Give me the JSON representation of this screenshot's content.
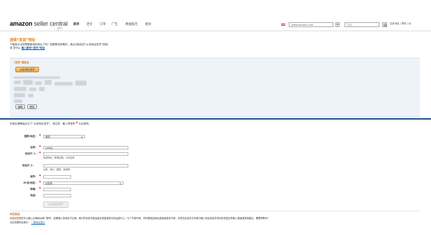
{
  "header": {
    "logo_main": "amazon",
    "logo_sub": " seller central",
    "flag_icon": "flag-icon",
    "nav": [
      "库存",
      "定价",
      "订单",
      "广告",
      "数据报告",
      "绩效"
    ],
    "marketplace": "www.amazon.com",
    "search_placeholder": "搜索",
    "right_links": "买家消息 | 帮助 | 设"
  },
  "section": {
    "title": "选择“发货”地址",
    "desc1": "下面显示出您想要使用的地址了吗？如果是这种情况，请点击相应的“从该地址发货”按钮。",
    "desc2_prefix": "或 您可以",
    "desc2_link": "输入新的“发货”地址",
    "default_label": "“发货”源签名",
    "ship_btn": "从此地址发货",
    "edit_btn": "编辑",
    "delete_btn": "删除"
  },
  "form": {
    "intro": "完成后请确保点击了“从该地址发货”。请注意：输入项带有",
    "intro_suffix": "为必填项。",
    "country_label": "国家/地区：",
    "country_value": "美国",
    "name_label": "名称：",
    "name_value": "Lafady",
    "addr1_label": "地址行 1：",
    "addr1_hint": "街道地址，邮政信箱，公司名称",
    "addr2_label": "地址行 2：",
    "addr2_hint": "大厦、单元、楼层、房间等",
    "city_label": "城市：",
    "state_label": "州/省/地区：",
    "state_value": "请选择...",
    "zip_label": "邮编：",
    "phone_label": "电话：",
    "submit_btn": "从该地址发货"
  },
  "footer": {
    "title": "地址验证",
    "text": "请务必在您的中心输入正确地址和门牌号，如果输入的地址不正确，我们的系统可能会建议到错误的仓库运营中心。为了节省时间，同时避免因地址错误而造成不便，请您在此处的文本框中输入地址信息并再次检查是否有输入错误或其他建议。需要帮助吗？",
    "text2_prefix": "点击查看地址提示：",
    "link": "一般地址提示"
  },
  "colors": {
    "accent_orange": "#e47911",
    "panel_bg": "#eef3f8",
    "divider_blue": "#1f4f8a",
    "required_red": "#cc0000"
  }
}
